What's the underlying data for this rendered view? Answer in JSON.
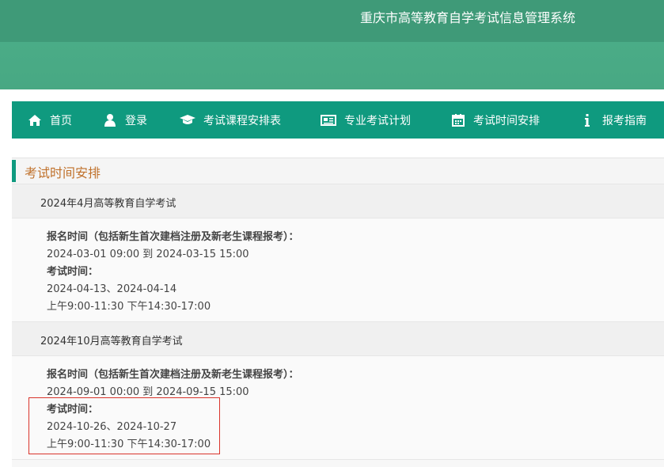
{
  "header": {
    "site_title": "重庆市高等教育自学考试信息管理系统"
  },
  "nav": {
    "items": [
      {
        "label": "首页",
        "icon": "home-icon"
      },
      {
        "label": "登录",
        "icon": "user-icon"
      },
      {
        "label": "考试课程安排表",
        "icon": "graduation-cap-icon"
      },
      {
        "label": "专业考试计划",
        "icon": "newspaper-icon"
      },
      {
        "label": "考试时间安排",
        "icon": "calendar-icon"
      },
      {
        "label": "报考指南",
        "icon": "info-icon"
      }
    ]
  },
  "section": {
    "title": "考试时间安排"
  },
  "exams": [
    {
      "name": "2024年4月高等教育自学考试",
      "reg_label": "报名时间（包括新生首次建档注册及新老生课程报考）：",
      "reg_range": "2024-03-01 09:00   到   2024-03-15 15:00",
      "exam_label": "考试时间：",
      "exam_dates": "2024-04-13、2024-04-14",
      "exam_hours": "上午9:00-11:30   下午14:30-17:00"
    },
    {
      "name": "2024年10月高等教育自学考试",
      "reg_label": "报名时间（包括新生首次建档注册及新老生课程报考）：",
      "reg_range": "2024-09-01 00:00   到   2024-09-15 15:00",
      "exam_label": "考试时间：",
      "exam_dates": "2024-10-26、2024-10-27",
      "exam_hours": "上午9:00-11:30   下午14:30-17:00"
    }
  ],
  "colors": {
    "nav_bg": "#0f9a7f",
    "header_bg": "#3f9a78",
    "section_title": "#c0712b",
    "highlight_border": "#d9342b"
  }
}
